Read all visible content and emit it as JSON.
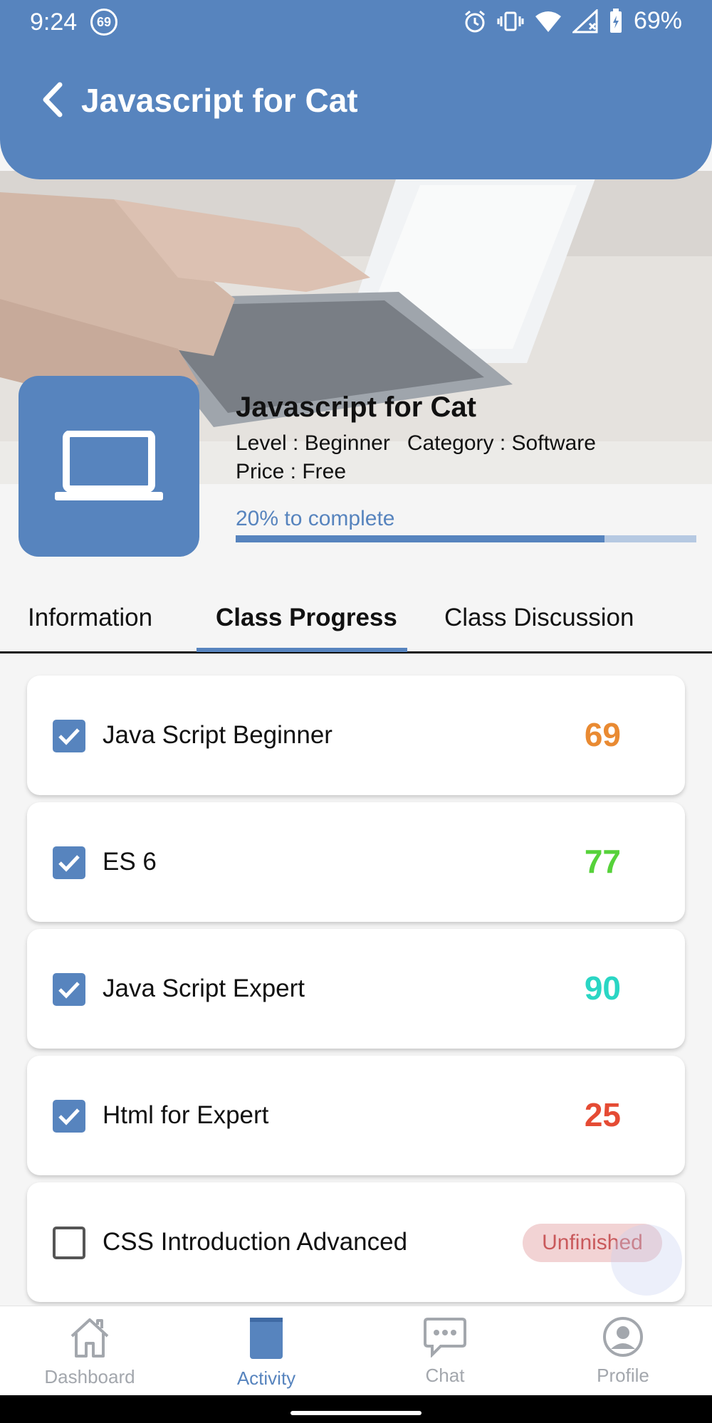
{
  "status_bar": {
    "time": "9:24",
    "notif_badge": "69",
    "battery": "69%"
  },
  "header": {
    "title": "Javascript for Cat",
    "back_icon": "chevron-left-icon",
    "bg_color": "#5784be"
  },
  "course": {
    "title": "Javascript for Cat",
    "level": "Level : Beginner",
    "category": "Category : Software",
    "price": "Price :  Free",
    "progress_label": "20% to complete",
    "progress_fraction": 0.8,
    "icon": "laptop-icon"
  },
  "tabs": [
    {
      "label": "Information",
      "active": false
    },
    {
      "label": "Class Progress",
      "active": true
    },
    {
      "label": "Class Discussion",
      "active": false
    }
  ],
  "progress_items": [
    {
      "label": "Java Script Beginner",
      "checked": true,
      "score": "69",
      "score_color": "#e98a32"
    },
    {
      "label": "ES 6",
      "checked": true,
      "score": "77",
      "score_color": "#56d23a"
    },
    {
      "label": "Java Script Expert",
      "checked": true,
      "score": "90",
      "score_color": "#2ad6c4"
    },
    {
      "label": "Html for Expert",
      "checked": true,
      "score": "25",
      "score_color": "#e54b34"
    },
    {
      "label": "CSS Introduction Advanced",
      "checked": false,
      "status": "Unfinished"
    }
  ],
  "bottom_nav": [
    {
      "label": "Dashboard",
      "icon": "home-icon",
      "active": false
    },
    {
      "label": "Activity",
      "icon": "book-icon",
      "active": true
    },
    {
      "label": "Chat",
      "icon": "chat-icon",
      "active": false
    },
    {
      "label": "Profile",
      "icon": "profile-icon",
      "active": false
    }
  ]
}
